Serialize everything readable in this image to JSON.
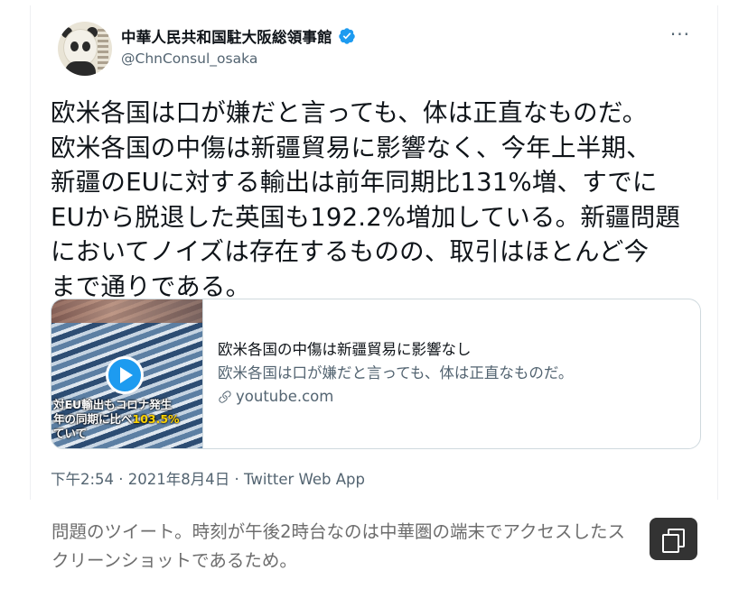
{
  "tweet": {
    "display_name": "中華人民共和国駐大阪総領事館",
    "handle": "@ChnConsul_osaka",
    "more_label": "···",
    "text": "欧米各国は口が嫌だと言っても、体は正直なものだ。\n欧米各国の中傷は新疆貿易に影響なく、今年上半期、\n新疆のEUに対する輸出は前年同期比131%増、すでに\nEUから脱退した英国も192.2%増加している。新疆問題\nにおいてノイズは存在するものの、取引はほとんど今\nまで通りである。",
    "timestamp": "下午2:54 · 2021年8月4日 · Twitter Web App",
    "link_card": {
      "thumbnail_caption_1": "対EU輸出もコロナ発生",
      "thumbnail_caption_2a": "年の同期に比べ",
      "thumbnail_caption_2b": "103.5%",
      "thumbnail_caption_3": "ていて",
      "title": "欧米各国の中傷は新疆貿易に影響なし",
      "description": "欧米各国は口が嫌だと言っても、体は正直なものだ。",
      "domain": "youtube.com"
    }
  },
  "caption": "問題のツイート。時刻が午後2時台なのは中華圏の端末でアクセスしたスクリーンショットであるため。",
  "icons": {
    "verified": "verified-badge-icon",
    "play": "play-icon",
    "link": "link-chain-icon",
    "copy": "copy-icon"
  },
  "colors": {
    "verified_blue": "#1d9bf0",
    "secondary_text": "#536471",
    "copy_button_bg": "#333333"
  }
}
